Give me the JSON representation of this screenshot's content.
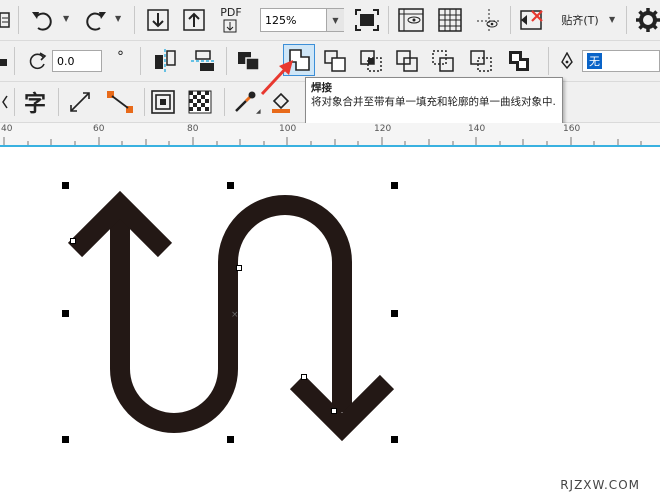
{
  "toolbar": {
    "pdf_label": "PDF",
    "zoom_value": "125%",
    "snap_label": "贴齐(T)",
    "rotation_value": "0.0",
    "degree_symbol": "°",
    "text_tool_glyph": "字",
    "outline_value": "无"
  },
  "tooltip": {
    "title": "焊接",
    "description": "将对象合并至带有单一填充和轮廓的单一曲线对象中."
  },
  "ruler": {
    "labels": [
      "40",
      "60",
      "80",
      "100",
      "120",
      "140",
      "160"
    ]
  },
  "watermark": "RJZXW.COM",
  "colors": {
    "toolbar_bg": "#f0f0f0",
    "ruler_accent": "#39b1e0",
    "shape_fill": "#231815",
    "highlight_border": "#3c8fd8",
    "pointer_arrow": "#e8382f",
    "no_outline_highlight": "#0a64c8"
  },
  "icons": [
    "align-left-icon",
    "undo-icon",
    "redo-icon",
    "import-icon",
    "export-icon",
    "publish-pdf-icon",
    "full-screen-icon",
    "view-grid-icon",
    "view-guides-icon",
    "close-doc-icon",
    "settings-icon",
    "rotate-icon",
    "mirror-h-icon",
    "mirror-v-icon",
    "group-icon",
    "weld-icon",
    "trim-icon",
    "intersect-icon",
    "simplify-icon",
    "front-minus-back-icon",
    "back-minus-front-icon",
    "boundary-icon",
    "pen-icon",
    "text-tool-icon",
    "dimension-icon",
    "connector-icon",
    "contour-icon",
    "transparency-icon",
    "eyedropper-icon",
    "fill-icon",
    "pointer-arrow-icon"
  ]
}
